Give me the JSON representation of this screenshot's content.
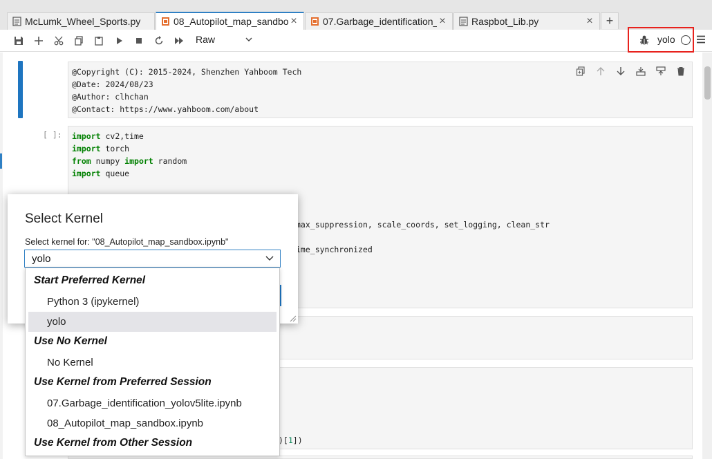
{
  "tabs": [
    {
      "label": "McLumk_Wheel_Sports.py",
      "type": "python-file",
      "active": false
    },
    {
      "label": "08_Autopilot_map_sandbo",
      "type": "notebook",
      "active": true
    },
    {
      "label": "07.Garbage_identification_",
      "type": "notebook",
      "active": false
    },
    {
      "label": "Raspbot_Lib.py",
      "type": "python-file",
      "active": false
    }
  ],
  "tab_close_glyph": "×",
  "add_tab_glyph": "+",
  "toolbar": {
    "cell_type": "Raw",
    "kernel_name": "yolo"
  },
  "cells": {
    "raw_cell_lines": [
      "@Copyright (C): 2015-2024, Shenzhen Yahboom Tech",
      "@Date: 2024/08/23",
      "@Author: clhchan",
      "@Contact: https://www.yahboom.com/about"
    ],
    "code_prompt": "[ ]:",
    "code_lines": [
      {
        "kw1": "import",
        "rest": " cv2,time"
      },
      {
        "kw1": "import",
        "rest": " torch"
      },
      {
        "kw1": "from",
        "mid": " numpy ",
        "kw2": "import",
        "rest": " random"
      },
      {
        "kw1": "import",
        "rest": " queue"
      }
    ],
    "partial_line_1": "max_suppression, scale_coords, set_logging, clean_str",
    "partial_line_2": "ime_synchronized",
    "partial_line_3_a": ")[",
    "partial_line_3_num": "1",
    "partial_line_3_b": "])"
  },
  "dialog": {
    "title": "Select Kernel",
    "label": "Select kernel for: \"08_Autopilot_map_sandbox.ipynb\"",
    "selected_value": "yolo"
  },
  "dropdown": {
    "headers": [
      "Start Preferred Kernel",
      "Use No Kernel",
      "Use Kernel from Preferred Session",
      "Use Kernel from Other Session"
    ],
    "items": [
      {
        "label": "Python 3 (ipykernel)",
        "selected": false
      },
      {
        "label": "yolo",
        "selected": true
      },
      {
        "label": "No Kernel",
        "selected": false
      },
      {
        "label": "07.Garbage_identification_yolov5lite.ipynb",
        "selected": false
      },
      {
        "label": "08_Autopilot_map_sandbox.ipynb",
        "selected": false
      }
    ]
  },
  "colors": {
    "accent": "#1e75c0",
    "highlight_box": "#e8221d",
    "keyword": "#008000",
    "notebook_icon": "#e46e2e",
    "number": "#098658"
  },
  "icons": [
    "save-icon",
    "add-cell-icon",
    "cut-icon",
    "copy-icon",
    "paste-icon",
    "run-icon",
    "stop-icon",
    "restart-icon",
    "fast-forward-icon",
    "chevron-down-icon",
    "bug-icon",
    "kernel-status-icon",
    "menu-icon",
    "duplicate-cell-icon",
    "move-up-icon",
    "move-down-icon",
    "insert-above-icon",
    "insert-below-icon",
    "delete-icon"
  ]
}
